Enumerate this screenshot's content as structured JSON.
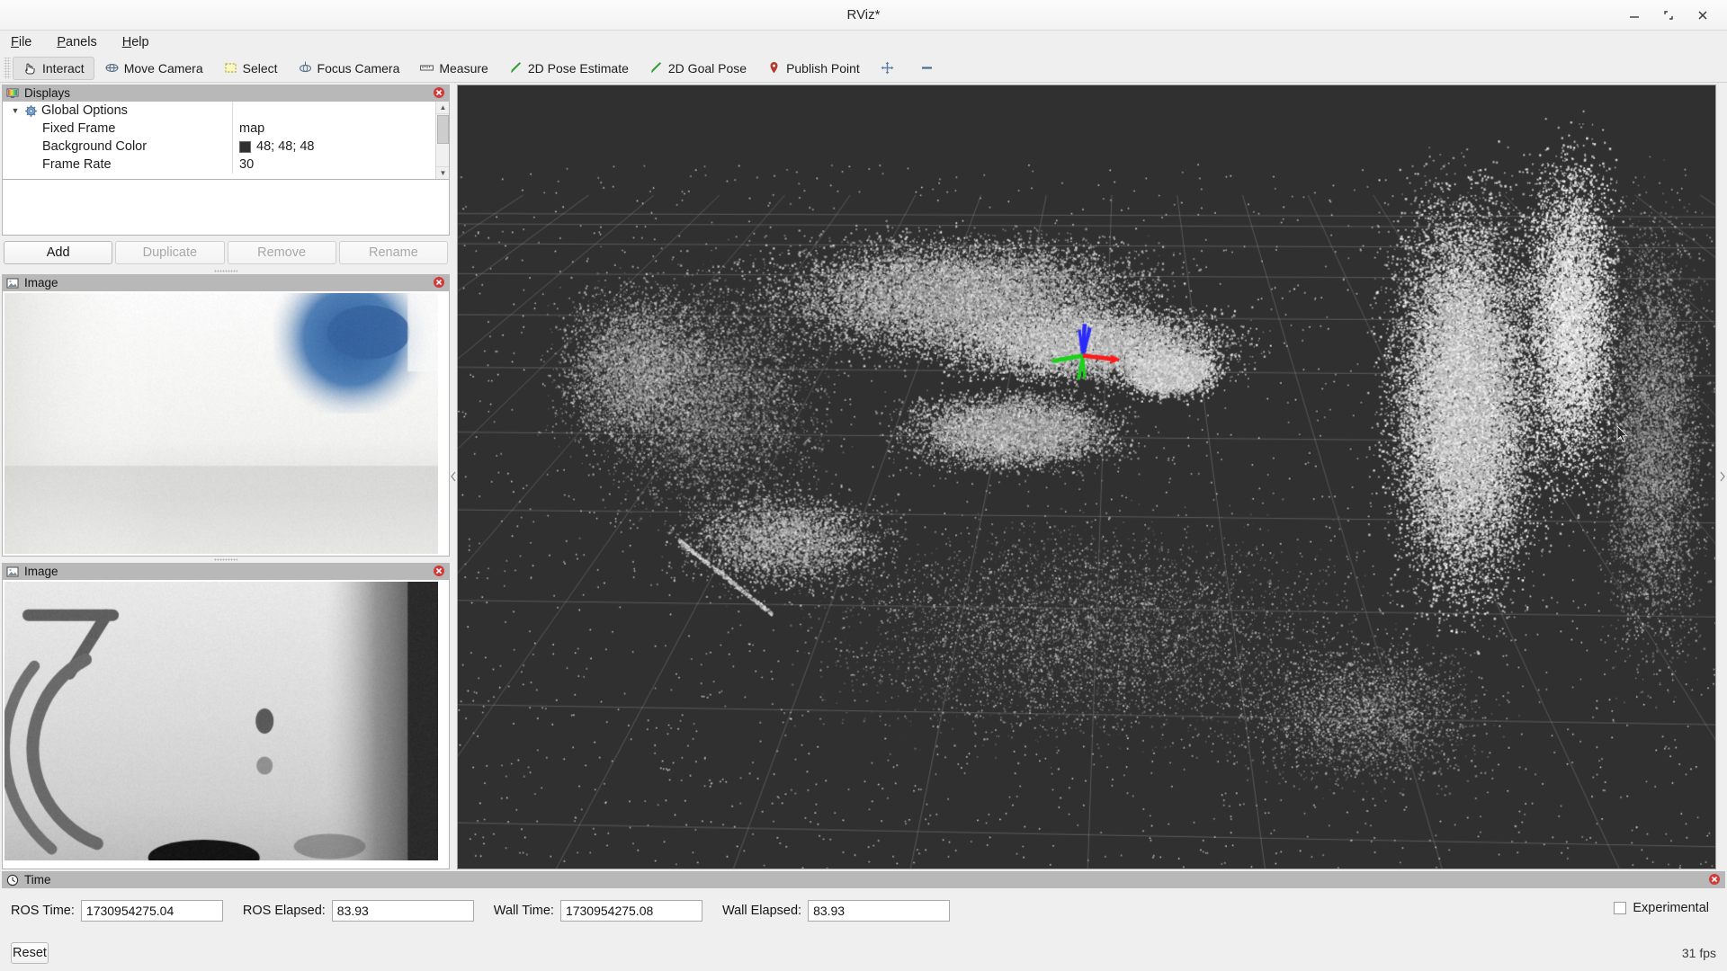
{
  "window": {
    "title": "RViz*",
    "controls": [
      {
        "name": "minimize-button",
        "glyph": "minimize-icon"
      },
      {
        "name": "maximize-button",
        "glyph": "maximize-icon"
      },
      {
        "name": "close-button",
        "glyph": "close-icon"
      }
    ]
  },
  "menubar": {
    "items": [
      {
        "label": "File",
        "mnemonic": "F"
      },
      {
        "label": "Panels",
        "mnemonic": "P"
      },
      {
        "label": "Help",
        "mnemonic": "H"
      }
    ]
  },
  "toolbar": {
    "buttons": [
      {
        "label": "Interact",
        "icon": "interact-hand-icon",
        "checked": true
      },
      {
        "label": "Move Camera",
        "icon": "move-camera-icon",
        "checked": false
      },
      {
        "label": "Select",
        "icon": "select-rect-icon",
        "checked": false
      },
      {
        "label": "Focus Camera",
        "icon": "focus-camera-icon",
        "checked": false
      },
      {
        "label": "Measure",
        "icon": "measure-ruler-icon",
        "checked": false
      },
      {
        "label": "2D Pose Estimate",
        "icon": "pose-arrow-green-icon",
        "checked": false
      },
      {
        "label": "2D Goal Pose",
        "icon": "goal-arrow-green-icon",
        "checked": false
      },
      {
        "label": "Publish Point",
        "icon": "map-pin-icon",
        "checked": false
      },
      {
        "label": "",
        "icon": "move-cross-icon",
        "checked": false
      },
      {
        "label": "",
        "icon": "dash-tool-icon",
        "checked": false
      }
    ]
  },
  "displays": {
    "panel_title": "Displays",
    "panel_icon": "displays-icon",
    "close_icon": "panel-close-icon",
    "tree": {
      "root": {
        "label": "Global Options",
        "icon": "gear-icon",
        "expanded": true
      },
      "properties": [
        {
          "key": "Fixed Frame",
          "value": "map",
          "swatch": null
        },
        {
          "key": "Background Color",
          "value": "48; 48; 48",
          "swatch": "#303030"
        },
        {
          "key": "Frame Rate",
          "value": "30",
          "swatch": null
        }
      ]
    },
    "buttons": [
      {
        "label": "Add",
        "enabled": true
      },
      {
        "label": "Duplicate",
        "enabled": false
      },
      {
        "label": "Remove",
        "enabled": false
      },
      {
        "label": "Rename",
        "enabled": false
      }
    ]
  },
  "image_panels": [
    {
      "panel_title": "Image",
      "panel_icon": "image-icon",
      "close_icon": "panel-close-icon",
      "content": "blurred-white-wall-with-blue-patch"
    },
    {
      "panel_title": "Image",
      "panel_icon": "image-icon",
      "close_icon": "panel-close-icon",
      "content": "grayscale-floor-with-dark-markings"
    }
  ],
  "view3d": {
    "name": "3d-render-view",
    "background_color": "#303030",
    "grid_color": "#8c8c8c",
    "axes": {
      "x_color": "#ff1a1a",
      "y_color": "#19d219",
      "z_color": "#2a2aff"
    },
    "content": "point-cloud-scene"
  },
  "time": {
    "panel_title": "Time",
    "panel_icon": "clock-icon",
    "close_icon": "panel-close-icon",
    "fields": [
      {
        "label": "ROS Time:",
        "value": "1730954275.04"
      },
      {
        "label": "ROS Elapsed:",
        "value": "83.93"
      },
      {
        "label": "Wall Time:",
        "value": "1730954275.08"
      },
      {
        "label": "Wall Elapsed:",
        "value": "83.93"
      }
    ],
    "experimental": {
      "label": "Experimental",
      "checked": false
    },
    "reset_button": "Reset",
    "fps": "31 fps"
  }
}
